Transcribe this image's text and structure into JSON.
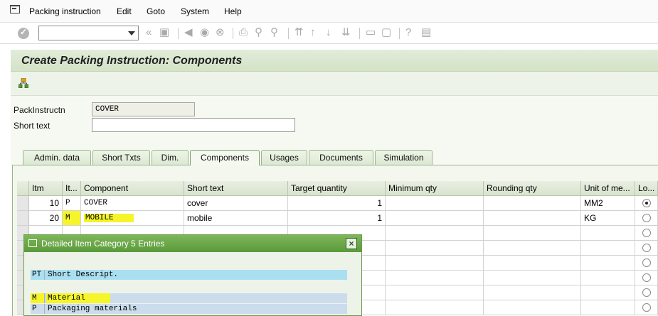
{
  "menu": {
    "items": [
      {
        "label": "Packing instruction"
      },
      {
        "label": "Edit"
      },
      {
        "label": "Goto"
      },
      {
        "label": "System"
      },
      {
        "label": "Help"
      }
    ]
  },
  "toolbar": {
    "command_value": ""
  },
  "page": {
    "title": "Create Packing Instruction: Components"
  },
  "header": {
    "packinstr_label": "PackInstructn",
    "packinstr_value": "COVER",
    "short_text_label": "Short text",
    "short_text_value": ""
  },
  "tabs": [
    {
      "label": "Admin. data",
      "active": false
    },
    {
      "label": "Short Txts",
      "active": false
    },
    {
      "label": "Dim.",
      "active": false
    },
    {
      "label": "Components",
      "active": true
    },
    {
      "label": "Usages",
      "active": false
    },
    {
      "label": "Documents",
      "active": false
    },
    {
      "label": "Simulation",
      "active": false
    }
  ],
  "grid": {
    "columns": [
      "Itm",
      "It...",
      "Component",
      "Short text",
      "Target quantity",
      "Minimum qty",
      "Rounding qty",
      "Unit of me...",
      "Lo..."
    ],
    "rows": [
      {
        "itm": "10",
        "cat": "P",
        "component": "COVER",
        "short_text": "cover",
        "target_qty": "1",
        "min_qty": "",
        "rounding_qty": "",
        "unit": "MM2",
        "selected": true
      },
      {
        "itm": "20",
        "cat": "M",
        "component": "MOBILE",
        "short_text": "mobile",
        "target_qty": "1",
        "min_qty": "",
        "rounding_qty": "",
        "unit": "KG",
        "selected": false
      }
    ]
  },
  "popup": {
    "title": "Detailed Item Category 5 Entries",
    "columns": {
      "key": "PT",
      "desc": "Short Descript."
    },
    "entries": [
      {
        "key": "M",
        "desc": "Material",
        "highlight": true
      },
      {
        "key": "P",
        "desc": "Packaging materials",
        "highlight": false
      }
    ]
  },
  "colors": {
    "highlight": "#f5f52a",
    "accent_green": "#5a9a3a",
    "title_bg": "#d4e2c8"
  }
}
